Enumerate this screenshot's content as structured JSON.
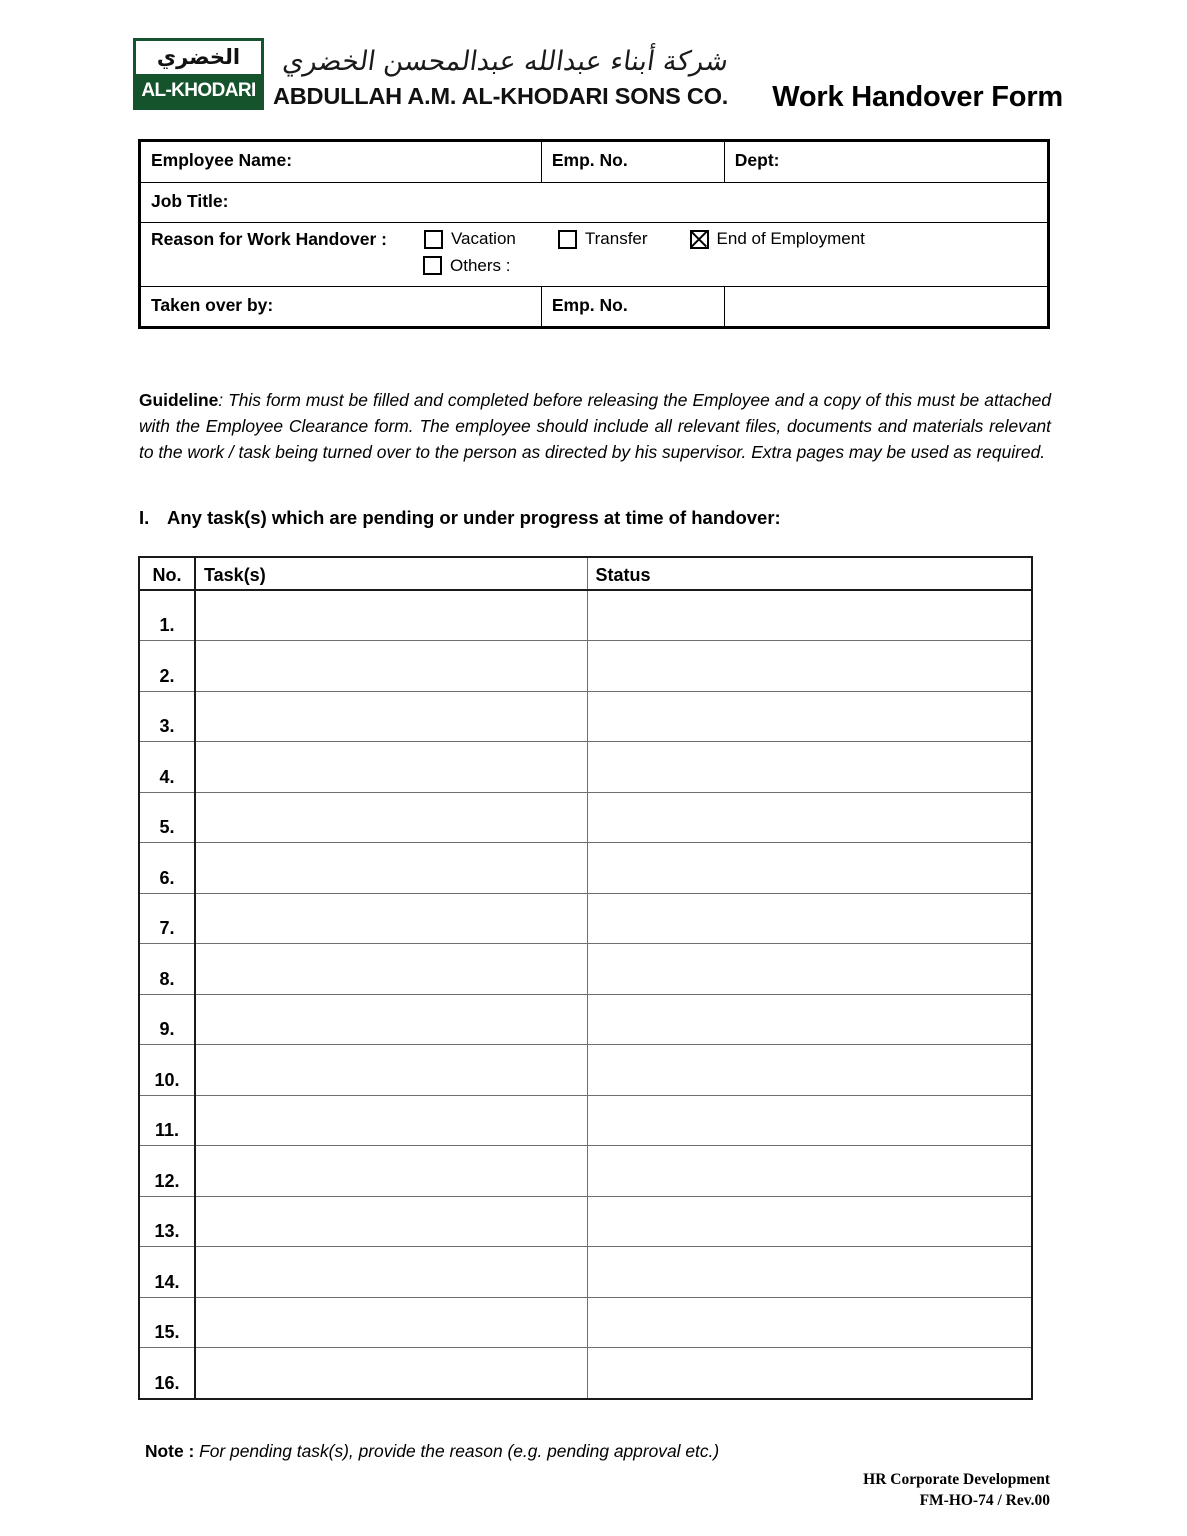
{
  "brand": {
    "logo_arabic": "الخضري",
    "logo_english": "AL-KHODARI",
    "arabic_script": "شركة أبناء عبدالله عبدالمحسن الخضري",
    "company_name": "ABDULLAH A.M. AL-KHODARI SONS CO.",
    "green": "#15532c"
  },
  "form_title": "Work Handover Form",
  "info": {
    "employee_name_label": "Employee Name:",
    "emp_no_label": "Emp. No.",
    "dept_label": "Dept:",
    "job_title_label": "Job Title:",
    "reason_label": "Reason for Work Handover :",
    "reason_options": [
      {
        "label": "Vacation",
        "checked": false
      },
      {
        "label": "Transfer",
        "checked": false
      },
      {
        "label": "End of Employment",
        "checked": true
      },
      {
        "label": "Others :",
        "checked": false
      }
    ],
    "taken_over_by_label": "Taken over by:",
    "taken_over_emp_no_label": "Emp. No.",
    "values": {
      "employee_name": "",
      "emp_no": "",
      "dept": "",
      "job_title": "",
      "others_text": "",
      "taken_over_by": "",
      "taken_over_emp_no": "",
      "taken_over_extra": ""
    }
  },
  "guideline": {
    "label": "Guideline",
    "text": ": This form must be filled and completed before releasing the Employee and a copy of this must be attached with the Employee Clearance form. The employee should include all relevant files, documents and materials relevant to the work / task being turned over to the person as directed by his supervisor. Extra pages may be used as required."
  },
  "section": {
    "number": "I.",
    "heading": "Any task(s) which are pending or under progress at time of handover:"
  },
  "task_table": {
    "columns": [
      "No.",
      "Task(s)",
      "Status"
    ],
    "rows": [
      {
        "no": "1.",
        "task": "",
        "status": ""
      },
      {
        "no": "2.",
        "task": "",
        "status": ""
      },
      {
        "no": "3.",
        "task": "",
        "status": ""
      },
      {
        "no": "4.",
        "task": "",
        "status": ""
      },
      {
        "no": "5.",
        "task": "",
        "status": ""
      },
      {
        "no": "6.",
        "task": "",
        "status": ""
      },
      {
        "no": "7.",
        "task": "",
        "status": ""
      },
      {
        "no": "8.",
        "task": "",
        "status": ""
      },
      {
        "no": "9.",
        "task": "",
        "status": ""
      },
      {
        "no": "10.",
        "task": "",
        "status": ""
      },
      {
        "no": "11.",
        "task": "",
        "status": ""
      },
      {
        "no": "12.",
        "task": "",
        "status": ""
      },
      {
        "no": "13.",
        "task": "",
        "status": ""
      },
      {
        "no": "14.",
        "task": "",
        "status": ""
      },
      {
        "no": "15.",
        "task": "",
        "status": ""
      },
      {
        "no": "16.",
        "task": "",
        "status": ""
      }
    ]
  },
  "note": {
    "label": "Note :",
    "text": " For pending task(s), provide the reason (e.g. pending approval etc.)"
  },
  "footer": {
    "line1": "HR Corporate Development",
    "line2": "FM-HO-74 / Rev.00"
  }
}
